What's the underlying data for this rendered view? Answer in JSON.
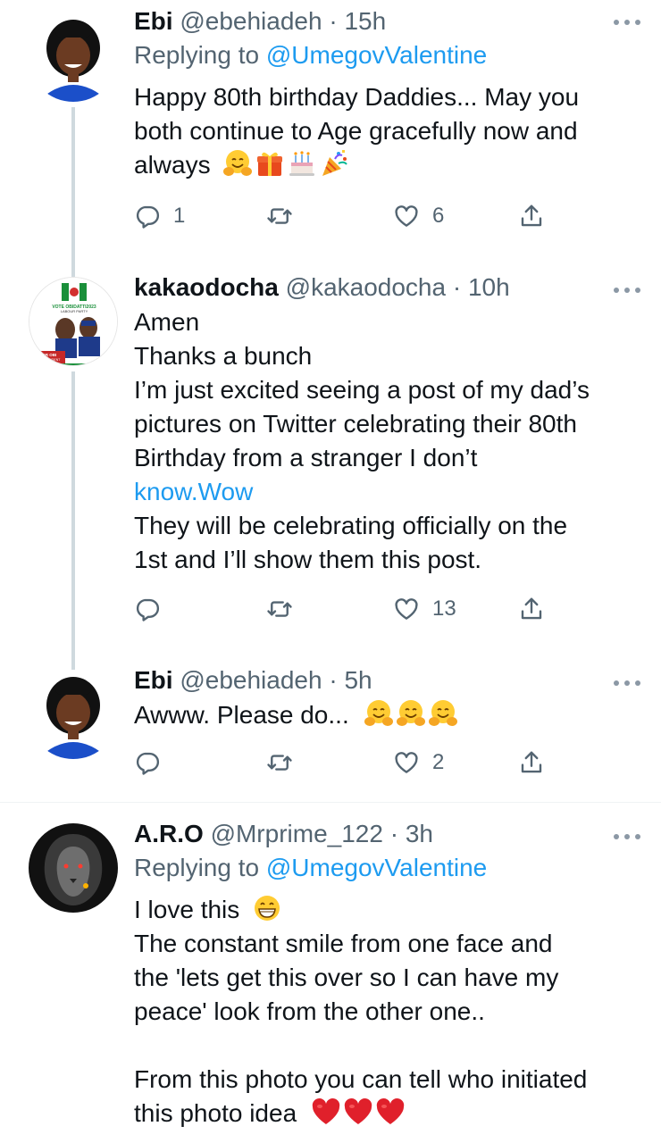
{
  "tweets": [
    {
      "name": "Ebi",
      "handle": "@ebehiadeh",
      "time": "15h",
      "replying_prefix": "Replying to ",
      "replying_to": "@UmegovValentine",
      "lines": [
        "Happy 80th birthday Daddies... May you",
        "both continue to Age gracefully now and",
        "always"
      ],
      "emojis": [
        "hugging-face",
        "wrapped-gift",
        "birthday-cake",
        "party-popper"
      ],
      "replies": "1",
      "retweets": "",
      "likes": "6"
    },
    {
      "name": "kakaodocha",
      "handle": "@kakaodocha",
      "time": "10h",
      "lines": [
        "Amen",
        "Thanks a bunch",
        "I’m just excited seeing a post of my dad’s",
        "pictures on Twitter celebrating their 80th",
        "Birthday from a stranger I don’t"
      ],
      "link": "know.Wow",
      "lines2": [
        "They will be celebrating officially on the",
        "1st and I’ll show them this post."
      ],
      "replies": "",
      "retweets": "",
      "likes": "13",
      "avatar_text": [
        "VOTE OBIDATTI2023",
        "LABOUR PARTY",
        "PETER OBI",
        "FOR PRESIDENT"
      ]
    },
    {
      "name": "Ebi",
      "handle": "@ebehiadeh",
      "time": "5h",
      "text": "Awww. Please do...",
      "emojis": [
        "hugging-face",
        "hugging-face",
        "hugging-face"
      ],
      "replies": "",
      "retweets": "",
      "likes": "2"
    },
    {
      "name": "A.R.O",
      "handle": "@Mrprime_122",
      "time": "3h",
      "replying_prefix": "Replying to ",
      "replying_to": "@UmegovValentine",
      "first_line": "I love this",
      "first_emoji": "grinning-face",
      "lines": [
        "The constant smile from one face and",
        "the 'lets get this over so I can have my",
        "peace' look from the other one..",
        "",
        "From this photo you can tell who initiated"
      ],
      "last_line": "this photo idea",
      "last_emojis": [
        "red-heart",
        "red-heart",
        "red-heart"
      ]
    }
  ],
  "colors": {
    "text": "#0f1419",
    "secondary": "#536471",
    "accent": "#1d9bf0",
    "thread_line": "#cfd9de"
  },
  "icons": {
    "reply": "reply-icon",
    "retweet": "retweet-icon",
    "like": "like-icon",
    "share": "share-icon",
    "more": "more-icon"
  }
}
